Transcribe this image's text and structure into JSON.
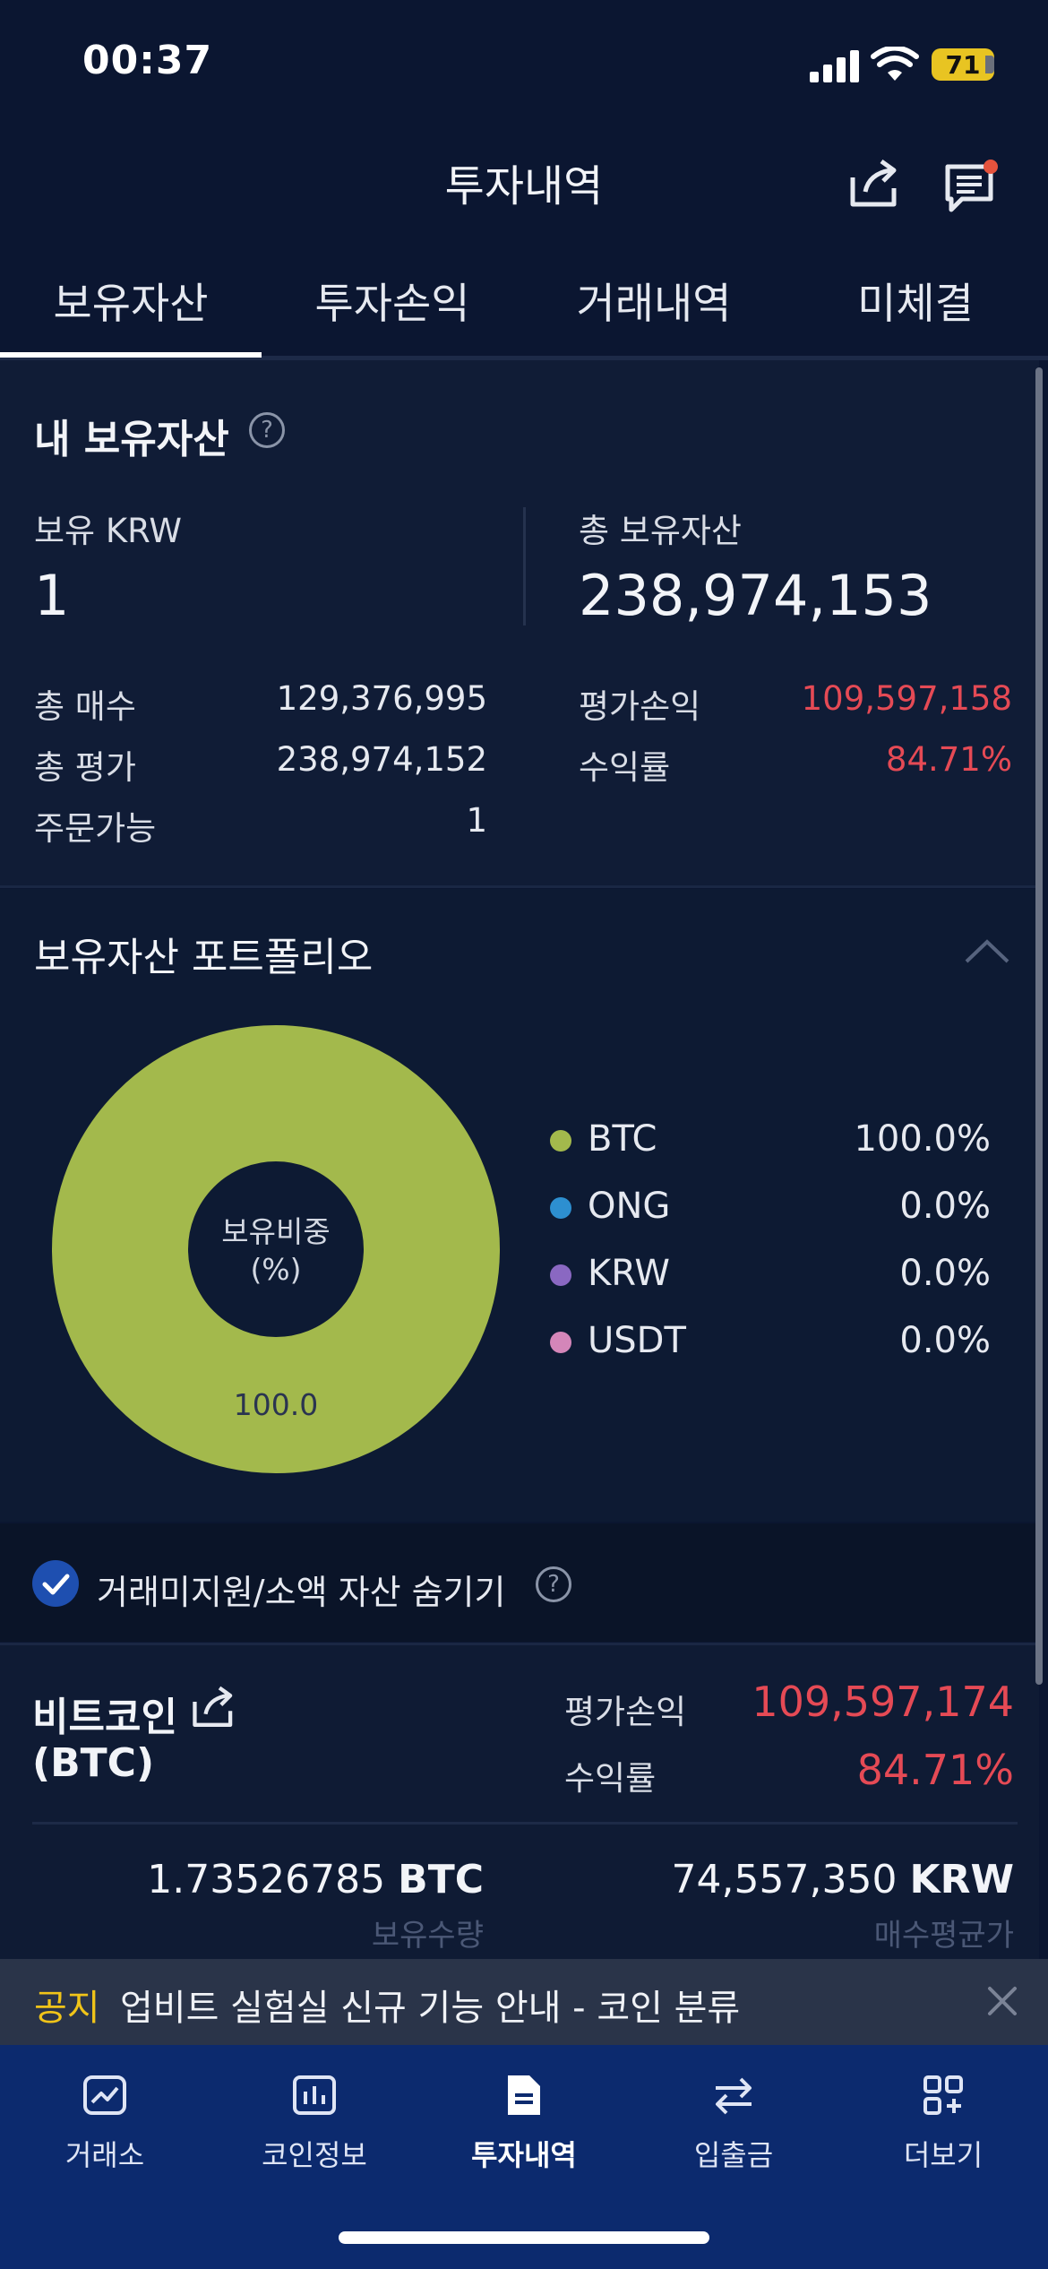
{
  "status": {
    "time": "00:37",
    "battery": "71"
  },
  "header": {
    "title": "투자내역"
  },
  "tabs": [
    "보유자산",
    "투자손익",
    "거래내역",
    "미체결"
  ],
  "assets": {
    "title": "내 보유자산",
    "help": "?",
    "krw_label": "보유 KRW",
    "krw_value": "1",
    "total_label": "총 보유자산",
    "total_value": "238,974,153",
    "rows_left": [
      {
        "label": "총 매수",
        "value": "129,376,995"
      },
      {
        "label": "총 평가",
        "value": "238,974,152"
      },
      {
        "label": "주문가능",
        "value": "1"
      }
    ],
    "rows_right": [
      {
        "label": "평가손익",
        "value": "109,597,158"
      },
      {
        "label": "수익률",
        "value": "84.71%"
      }
    ]
  },
  "portfolio": {
    "title": "보유자산 포트폴리오",
    "donut_center_line1": "보유비중",
    "donut_center_line2": "(%)",
    "donut_value_label": "100.0",
    "legend": [
      {
        "name": "BTC",
        "value": "100.0%",
        "color": "#a3b94c"
      },
      {
        "name": "ONG",
        "value": "0.0%",
        "color": "#2d8fd0"
      },
      {
        "name": "KRW",
        "value": "0.0%",
        "color": "#8a68c2"
      },
      {
        "name": "USDT",
        "value": "0.0%",
        "color": "#d486b9"
      }
    ]
  },
  "hide_option": {
    "label": "거래미지원/소액 자산 숨기기",
    "checked": true,
    "help": "?"
  },
  "coin": {
    "name": "비트코인",
    "symbol": "(BTC)",
    "pnl_label": "평가손익",
    "pnl_value": "109,597,174",
    "rate_label": "수익률",
    "rate_value": "84.71%",
    "qty_value": "1.73526785",
    "qty_unit": "BTC",
    "qty_caption": "보유수량",
    "avg_value": "74,557,350",
    "avg_unit": "KRW",
    "avg_caption": "매수평균가"
  },
  "notice": {
    "label": "공지",
    "text": "업비트 실험실 신규 기능 안내 - 코인 분류"
  },
  "nav": [
    {
      "label": "거래소",
      "icon": "chart-line-icon",
      "active": false
    },
    {
      "label": "코인정보",
      "icon": "bar-chart-icon",
      "active": false
    },
    {
      "label": "투자내역",
      "icon": "document-icon",
      "active": true
    },
    {
      "label": "입출금",
      "icon": "transfer-icon",
      "active": false
    },
    {
      "label": "더보기",
      "icon": "grid-plus-icon",
      "active": false
    }
  ],
  "colors": {
    "background": "#0b1631",
    "accent_red": "#e54a55",
    "donut": "#a3b94c",
    "nav_bg": "#0c2a6e"
  }
}
